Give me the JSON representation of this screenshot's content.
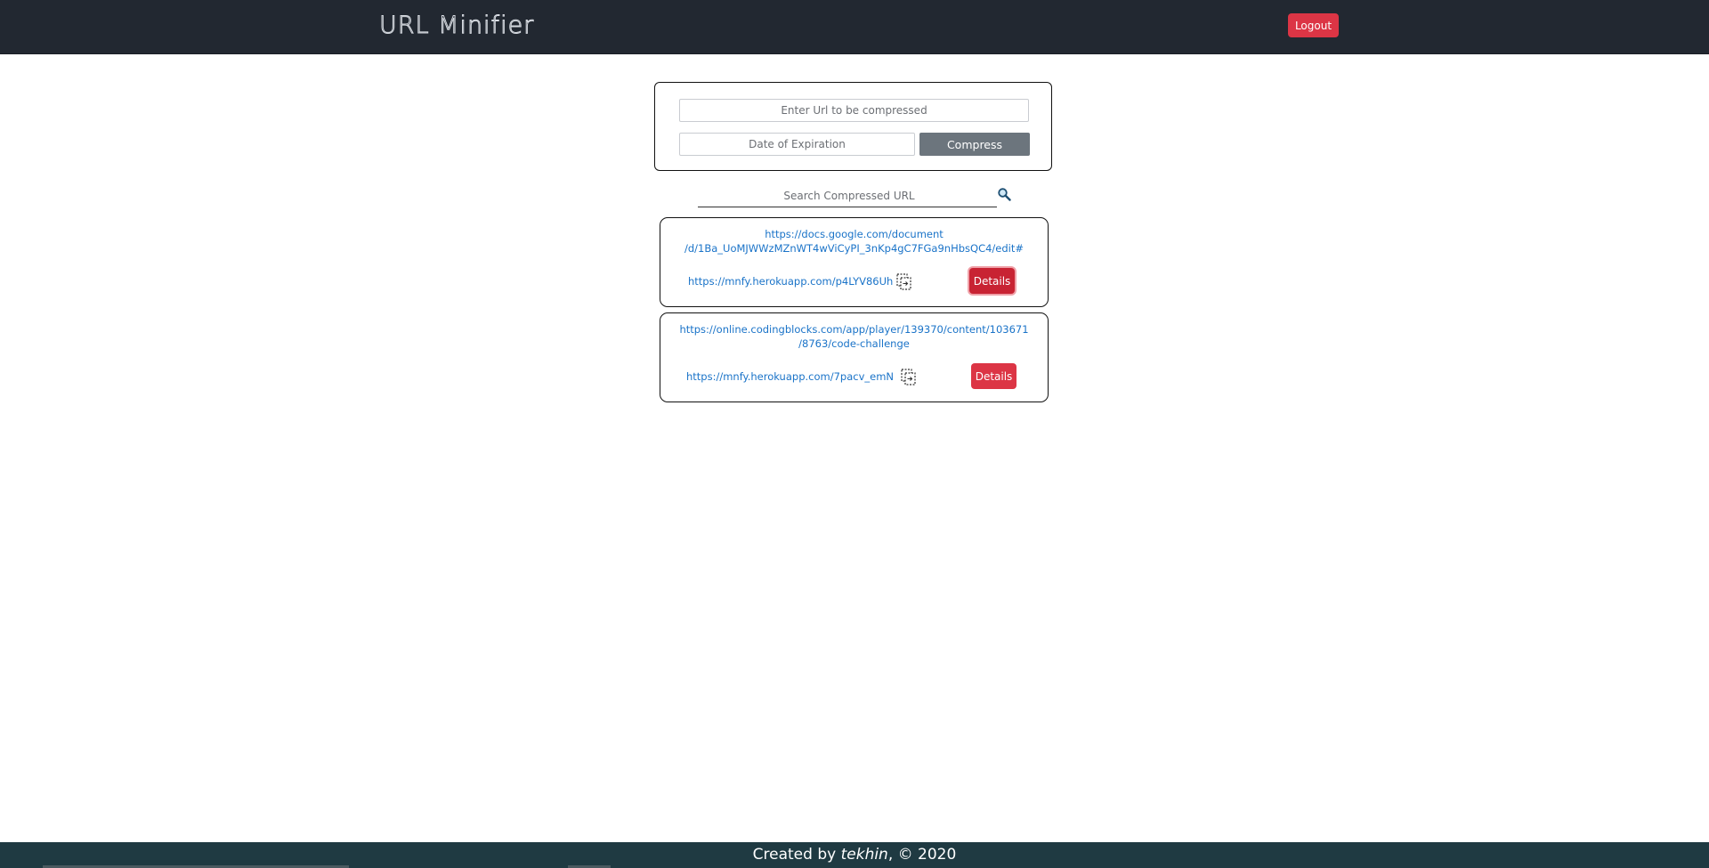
{
  "header": {
    "brand": "URL Minifier",
    "logout_label": "Logout"
  },
  "compress_form": {
    "url_placeholder": "Enter Url to be compressed",
    "date_placeholder": "Date of Expiration",
    "compress_label": "Compress"
  },
  "search": {
    "placeholder": "Search Compressed URL",
    "icon": "search-icon"
  },
  "urls": [
    {
      "original_line1": "https://docs.google.com/document",
      "original_line2": "/d/1Ba_UoMJWWzMZnWT4wViCyPI_3nKp4gC7FGa9nHbsQC4/edit#",
      "short": "https://mnfy.herokuapp.com/p4LYV86Uh",
      "details_label": "Details"
    },
    {
      "original_line1": "https://online.codingblocks.com/app/player/139370/content/103671",
      "original_line2": "/8763/code-challenge",
      "short": "https://mnfy.herokuapp.com/7pacv_emN",
      "details_label": "Details"
    }
  ],
  "footer": {
    "prefix": "Created by ",
    "author": "tekhin",
    "suffix": ", © 2020"
  },
  "colors": {
    "navbar": "#222831",
    "danger": "#dc3545",
    "secondary": "#6c757d",
    "link": "#1a73c8",
    "footer": "#1f3a42"
  }
}
